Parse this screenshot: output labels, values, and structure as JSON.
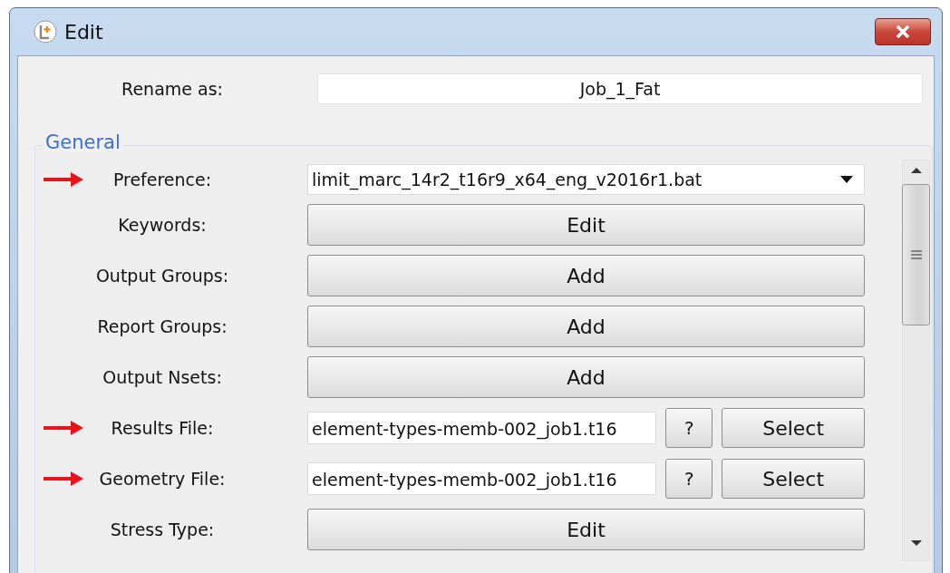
{
  "window": {
    "title": "Edit"
  },
  "rename": {
    "label": "Rename as:",
    "value": "Job_1_Fat"
  },
  "group": {
    "title": "General"
  },
  "rows": [
    {
      "kind": "combo",
      "label": "Preference:",
      "arrow": true,
      "value": "limit_marc_14r2_t16r9_x64_eng_v2016r1.bat"
    },
    {
      "kind": "button",
      "label": "Keywords:",
      "arrow": false,
      "button": "Edit"
    },
    {
      "kind": "button",
      "label": "Output Groups:",
      "arrow": false,
      "button": "Add"
    },
    {
      "kind": "button",
      "label": "Report Groups:",
      "arrow": false,
      "button": "Add"
    },
    {
      "kind": "button",
      "label": "Output Nsets:",
      "arrow": false,
      "button": "Add"
    },
    {
      "kind": "file",
      "label": "Results File:",
      "arrow": true,
      "value": "element-types-memb-002_job1.t16",
      "help": "?",
      "button": "Select"
    },
    {
      "kind": "file",
      "label": "Geometry File:",
      "arrow": true,
      "value": "element-types-memb-002_job1.t16",
      "help": "?",
      "button": "Select"
    },
    {
      "kind": "button",
      "label": "Stress Type:",
      "arrow": false,
      "button": "Edit"
    }
  ]
}
